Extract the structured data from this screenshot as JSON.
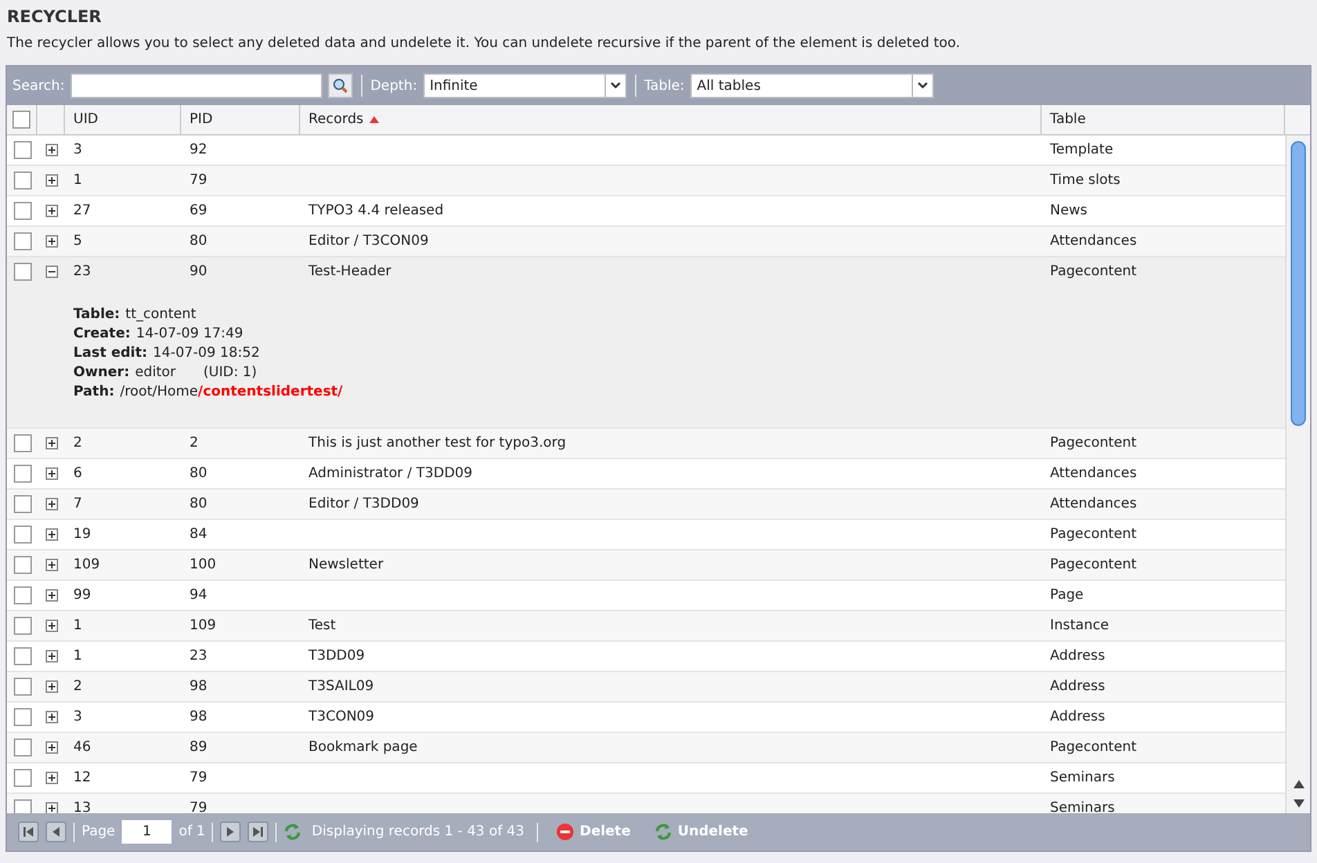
{
  "title": "RECYCLER",
  "description": "The recycler allows you to select any deleted data and undelete it. You can undelete recursive if the parent of the element is deleted too.",
  "toolbar": {
    "search_label": "Search:",
    "depth_label": "Depth:",
    "depth_value": "Infinite",
    "table_label": "Table:",
    "table_value": "All tables"
  },
  "select_all_checked": false,
  "columns": [
    {
      "label": "UID",
      "sorted": false
    },
    {
      "label": "PID",
      "sorted": false
    },
    {
      "label": "Records",
      "sorted": true
    },
    {
      "label": "Table",
      "sorted": false
    }
  ],
  "rows": [
    {
      "uid": "3",
      "pid": "92",
      "table": "Template",
      "checked": false,
      "expanded": false
    },
    {
      "uid": "1",
      "pid": "79",
      "table": "Time slots",
      "checked": false,
      "expanded": false
    },
    {
      "uid": "27",
      "pid": "69",
      "record": "TYPO3 4.4 released",
      "table": "News",
      "checked": false,
      "expanded": false
    },
    {
      "uid": "5",
      "pid": "80",
      "record": "Editor / T3CON09",
      "table": "Attendances",
      "checked": false,
      "expanded": false
    },
    {
      "uid": "23",
      "pid": "90",
      "record": "Test-Header",
      "table": "Pagecontent",
      "checked": false,
      "expanded": true,
      "details": [
        {
          "label": "Table:",
          "value": "tt_content"
        },
        {
          "label": "Create:",
          "value": "14-07-09 17:49"
        },
        {
          "label": "Last edit:",
          "value": "14-07-09 18:52"
        },
        {
          "label": "Owner:",
          "value": "editor",
          "note": "(UID: 1)"
        },
        {
          "label": "Path:",
          "value": "/root/Home",
          "highlight": "/contentslidertest/"
        }
      ]
    },
    {
      "uid": "2",
      "pid": "2",
      "record": "This is just another test for typo3.org",
      "table": "Pagecontent",
      "checked": false,
      "expanded": false
    },
    {
      "uid": "6",
      "pid": "80",
      "record": "Administrator / T3DD09",
      "table": "Attendances",
      "checked": false,
      "expanded": false
    },
    {
      "uid": "7",
      "pid": "80",
      "record": "Editor / T3DD09",
      "table": "Attendances",
      "checked": false,
      "expanded": false
    },
    {
      "uid": "19",
      "pid": "84",
      "table": "Pagecontent",
      "checked": false,
      "expanded": false
    },
    {
      "uid": "109",
      "pid": "100",
      "record": "Newsletter",
      "table": "Pagecontent",
      "checked": false,
      "expanded": false
    },
    {
      "uid": "99",
      "pid": "94",
      "table": "Page",
      "checked": false,
      "expanded": false
    },
    {
      "uid": "1",
      "pid": "109",
      "record": "Test",
      "table": "Instance",
      "checked": false,
      "expanded": false
    },
    {
      "uid": "1",
      "pid": "23",
      "record": "T3DD09",
      "table": "Address",
      "checked": false,
      "expanded": false
    },
    {
      "uid": "2",
      "pid": "98",
      "record": "T3SAIL09",
      "table": "Address",
      "checked": false,
      "expanded": false
    },
    {
      "uid": "3",
      "pid": "98",
      "record": "T3CON09",
      "table": "Address",
      "checked": false,
      "expanded": false
    },
    {
      "uid": "46",
      "pid": "89",
      "record": "Bookmark page",
      "table": "Pagecontent",
      "checked": false,
      "expanded": false
    },
    {
      "uid": "12",
      "pid": "79",
      "table": "Seminars",
      "checked": false,
      "expanded": false
    },
    {
      "uid": "13",
      "pid": "79",
      "table": "Seminars",
      "checked": false,
      "expanded": false
    }
  ],
  "footer": {
    "page_label": "Page",
    "page_value": "1",
    "page_of": "of 1",
    "status": "Displaying records 1 - 43 of 43",
    "delete": "Delete",
    "undelete": "Undelete"
  }
}
